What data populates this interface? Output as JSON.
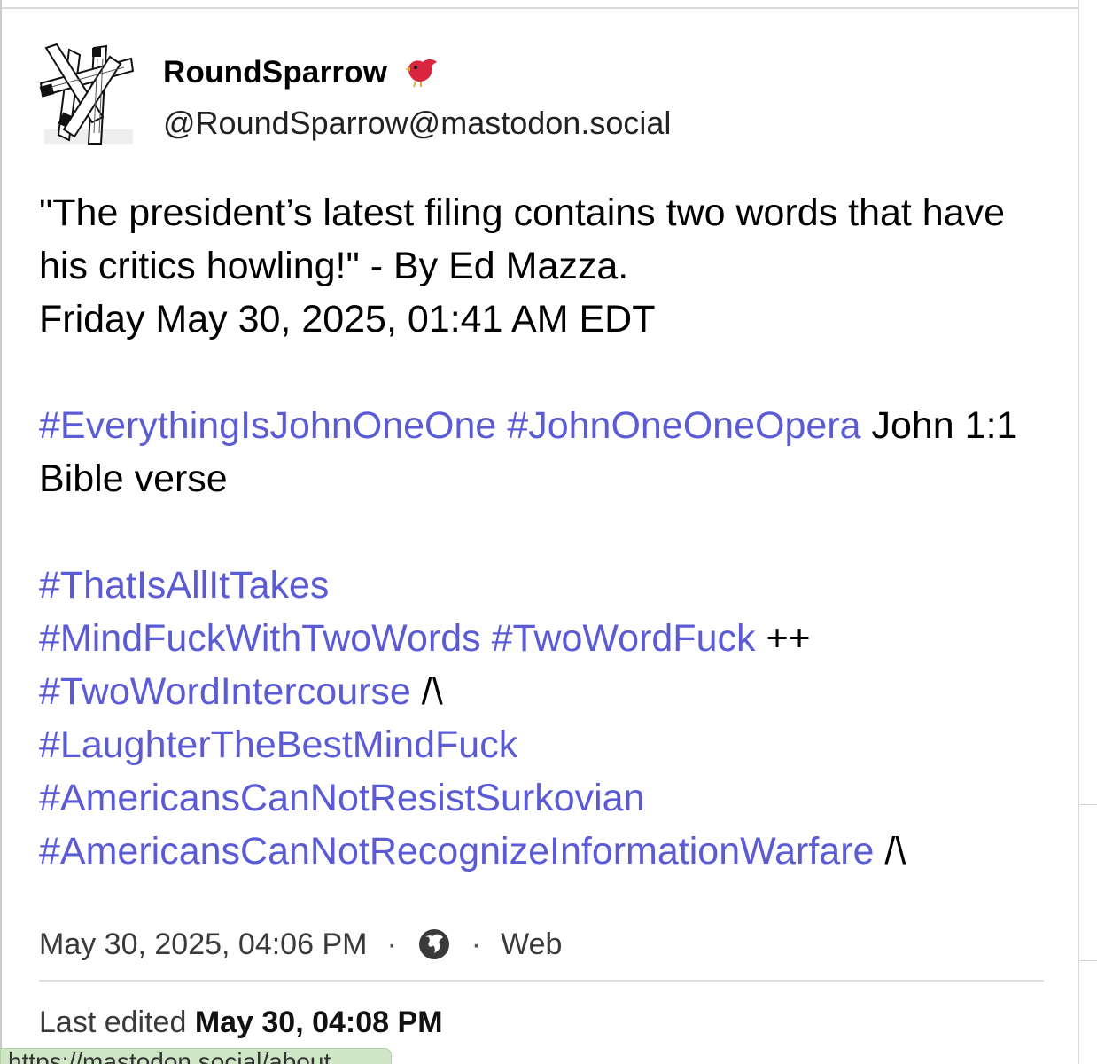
{
  "author": {
    "display_name": "RoundSparrow",
    "handle": "@RoundSparrow@mastodon.social",
    "avatar_icon": "sticks-avatar-icon",
    "badge_icon": "red-bird-icon"
  },
  "content": {
    "line1": "\"The president’s latest filing contains two words that have his critics howling!\" - By Ed Mazza.",
    "line2": "Friday May 30, 2025, 01:41 AM EDT",
    "tag1": "#EverythingIsJohnOneOne",
    "tag2": "#JohnOneOneOpera",
    "text_after_tag2": " John 1:1 Bible verse",
    "tag3": "#ThatIsAllItTakes",
    "tag4": "#MindFuckWithTwoWords",
    "tag5": "#TwoWordFuck",
    "text_after_tag5": " ++",
    "tag6": "#TwoWordIntercourse",
    "text_after_tag6": " /\\",
    "tag7": "#LaughterTheBestMindFuck",
    "tag8": "#AmericansCanNotResistSurkovian",
    "tag9": "#AmericansCanNotRecognizeInformationWarfare",
    "text_after_tag9": " /\\"
  },
  "meta": {
    "timestamp": "May 30, 2025, 04:06 PM",
    "separator": "·",
    "visibility_icon": "globe-icon",
    "application": "Web"
  },
  "edited": {
    "label": "Last edited",
    "value": "May 30, 04:08 PM"
  },
  "status_bar": {
    "url": "https://mastodon.social/about"
  },
  "colors": {
    "hashtag": "#5b5bd6",
    "bird": "#d7263d"
  }
}
